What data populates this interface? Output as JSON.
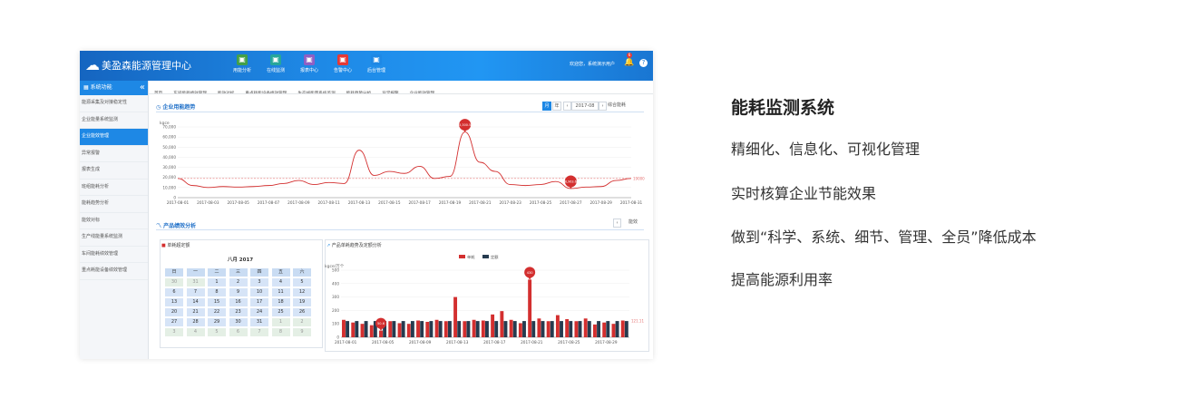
{
  "app": {
    "title": "美盈森能源管理中心",
    "nav": [
      {
        "label": "用能分析",
        "icon": "bar-chart-icon",
        "color": "#43a047"
      },
      {
        "label": "在线监测",
        "icon": "monitor-icon",
        "color": "#26a69a"
      },
      {
        "label": "报表中心",
        "icon": "report-icon",
        "color": "#8e5fc4"
      },
      {
        "label": "告警中心",
        "icon": "alarm-icon",
        "color": "#e53935"
      },
      {
        "label": "后台管理",
        "icon": "layers-icon",
        "color": "#1e88e5"
      }
    ],
    "welcome": "欢迎您，系统演示用户",
    "notification_count": "6"
  },
  "sidebar": {
    "header": "系统功能",
    "items": [
      "能源采集及对接稳定性",
      "企业能量系统监测",
      "企业能效管理",
      "异常报警",
      "报表生成",
      "班组能耗分析",
      "能耗趋势分析",
      "能效对标",
      "生产线能量系统监测",
      "车间能耗绩效管理",
      "重点耗能设备绩效管理"
    ],
    "active_index": 2
  },
  "tabs": [
    "首页",
    "车间能耗绩效管理",
    "能效对标",
    "重点耗能设备绩效管理",
    "生产线能量系统监测",
    "能耗趋势分析",
    "异常报警",
    "企业能效管理"
  ],
  "section1": {
    "title": "企业用能趋势",
    "controls": {
      "month": "月",
      "year": "年",
      "prev": "‹",
      "period": "2017-08",
      "next": "›",
      "combo": "综合能耗"
    }
  },
  "section2": {
    "title": "产品绩效分析",
    "controls": {
      "prev": "‹",
      "label": "能效"
    }
  },
  "calendar_panel": {
    "title": "单耗超定额",
    "month": "八月 2017",
    "weekdays": [
      "日",
      "一",
      "二",
      "三",
      "四",
      "五",
      "六"
    ],
    "rows": [
      [
        {
          "d": "30",
          "o": true
        },
        {
          "d": "31",
          "o": true
        },
        {
          "d": "1"
        },
        {
          "d": "2"
        },
        {
          "d": "3"
        },
        {
          "d": "4"
        },
        {
          "d": "5"
        }
      ],
      [
        {
          "d": "6"
        },
        {
          "d": "7"
        },
        {
          "d": "8"
        },
        {
          "d": "9"
        },
        {
          "d": "10"
        },
        {
          "d": "11"
        },
        {
          "d": "12"
        }
      ],
      [
        {
          "d": "13"
        },
        {
          "d": "14"
        },
        {
          "d": "15"
        },
        {
          "d": "16"
        },
        {
          "d": "17"
        },
        {
          "d": "18"
        },
        {
          "d": "19"
        }
      ],
      [
        {
          "d": "20"
        },
        {
          "d": "21"
        },
        {
          "d": "22"
        },
        {
          "d": "23"
        },
        {
          "d": "24"
        },
        {
          "d": "25"
        },
        {
          "d": "26"
        }
      ],
      [
        {
          "d": "27"
        },
        {
          "d": "28"
        },
        {
          "d": "29"
        },
        {
          "d": "30"
        },
        {
          "d": "31"
        },
        {
          "d": "1",
          "o": true
        },
        {
          "d": "2",
          "o": true
        }
      ],
      [
        {
          "d": "3",
          "o": true
        },
        {
          "d": "4",
          "o": true
        },
        {
          "d": "5",
          "o": true
        },
        {
          "d": "6",
          "o": true
        },
        {
          "d": "7",
          "o": true
        },
        {
          "d": "8",
          "o": true
        },
        {
          "d": "9",
          "o": true
        }
      ]
    ]
  },
  "bar_panel": {
    "title": "产品单耗趋势及定额分析"
  },
  "chart_data": [
    {
      "type": "line",
      "title": "",
      "ylabel": "kgce",
      "ylim": [
        0,
        70000
      ],
      "yticks": [
        "0",
        "10,000",
        "20,000",
        "30,000",
        "40,000",
        "50,000",
        "60,000",
        "70,000"
      ],
      "x": [
        "2017-08-01",
        "2017-08-02",
        "2017-08-03",
        "2017-08-04",
        "2017-08-05",
        "2017-08-06",
        "2017-08-07",
        "2017-08-08",
        "2017-08-09",
        "2017-08-10",
        "2017-08-11",
        "2017-08-12",
        "2017-08-13",
        "2017-08-14",
        "2017-08-15",
        "2017-08-16",
        "2017-08-17",
        "2017-08-18",
        "2017-08-19",
        "2017-08-20",
        "2017-08-21",
        "2017-08-22",
        "2017-08-23",
        "2017-08-24",
        "2017-08-25",
        "2017-08-26",
        "2017-08-27",
        "2017-08-28",
        "2017-08-29",
        "2017-08-30",
        "2017-08-31"
      ],
      "xtick_labels": [
        "2017-08-01",
        "2017-08-03",
        "2017-08-05",
        "2017-08-07",
        "2017-08-09",
        "2017-08-11",
        "2017-08-13",
        "2017-08-15",
        "2017-08-17",
        "2017-08-19",
        "2017-08-21",
        "2017-08-23",
        "2017-08-25",
        "2017-08-27",
        "2017-08-29",
        "2017-08-31"
      ],
      "series": [
        {
          "values": [
            19000,
            12000,
            10000,
            11000,
            10500,
            11000,
            12000,
            14000,
            17000,
            13000,
            15000,
            14000,
            47000,
            22000,
            26000,
            24000,
            31000,
            19000,
            21000,
            65000,
            35000,
            26000,
            13000,
            12000,
            13000,
            16000,
            9000,
            10500,
            11000,
            17000,
            19000
          ],
          "color": "#d32f2f"
        }
      ],
      "reference": {
        "value": 19000
      },
      "markers": [
        {
          "index": 19,
          "label": "65,300.58"
        },
        {
          "index": 26,
          "label": "8,963.6"
        }
      ],
      "end_label": "19000"
    },
    {
      "type": "bar",
      "title": "",
      "ylabel": "kgce/万个",
      "ylim": [
        0,
        500
      ],
      "yticks": [
        "0",
        "100",
        "200",
        "300",
        "400",
        "500"
      ],
      "legend": [
        {
          "name": "单耗",
          "color": "#d32f2f"
        },
        {
          "name": "定额",
          "color": "#263b4f"
        }
      ],
      "categories": [
        "2017-08-01",
        "2017-08-02",
        "2017-08-03",
        "2017-08-04",
        "2017-08-05",
        "2017-08-06",
        "2017-08-07",
        "2017-08-08",
        "2017-08-09",
        "2017-08-10",
        "2017-08-11",
        "2017-08-12",
        "2017-08-13",
        "2017-08-14",
        "2017-08-15",
        "2017-08-16",
        "2017-08-17",
        "2017-08-18",
        "2017-08-19",
        "2017-08-20",
        "2017-08-21",
        "2017-08-22",
        "2017-08-23",
        "2017-08-24",
        "2017-08-25",
        "2017-08-26",
        "2017-08-27",
        "2017-08-28",
        "2017-08-29",
        "2017-08-30",
        "2017-08-31"
      ],
      "xtick_labels": [
        "2017-08-01",
        "2017-08-05",
        "2017-08-09",
        "2017-08-13",
        "2017-08-17",
        "2017-08-21",
        "2017-08-25",
        "2017-08-29"
      ],
      "series": [
        {
          "name": "单耗",
          "values": [
            130,
            110,
            100,
            90,
            50,
            120,
            105,
            100,
            125,
            115,
            130,
            120,
            300,
            120,
            130,
            125,
            170,
            195,
            130,
            105,
            430,
            140,
            120,
            165,
            135,
            120,
            140,
            95,
            110,
            100,
            125
          ],
          "color": "#d32f2f"
        },
        {
          "name": "定额",
          "values": [
            121,
            121,
            121,
            121,
            121,
            121,
            121,
            121,
            121,
            121,
            121,
            121,
            121,
            121,
            121,
            121,
            121,
            121,
            121,
            121,
            121,
            121,
            121,
            121,
            121,
            121,
            121,
            121,
            121,
            121,
            121
          ],
          "color": "#263b4f"
        }
      ],
      "markers": [
        {
          "index": 4,
          "label": "50.6"
        },
        {
          "index": 20,
          "label": "430"
        }
      ],
      "end_label": "121.11"
    }
  ],
  "copy": {
    "title": "能耗监测系统",
    "lines": [
      "精细化、信息化、可视化管理",
      "实时核算企业节能效果",
      "做到“科学、系统、细节、管理、全员”降低成本",
      "提高能源利用率"
    ]
  }
}
